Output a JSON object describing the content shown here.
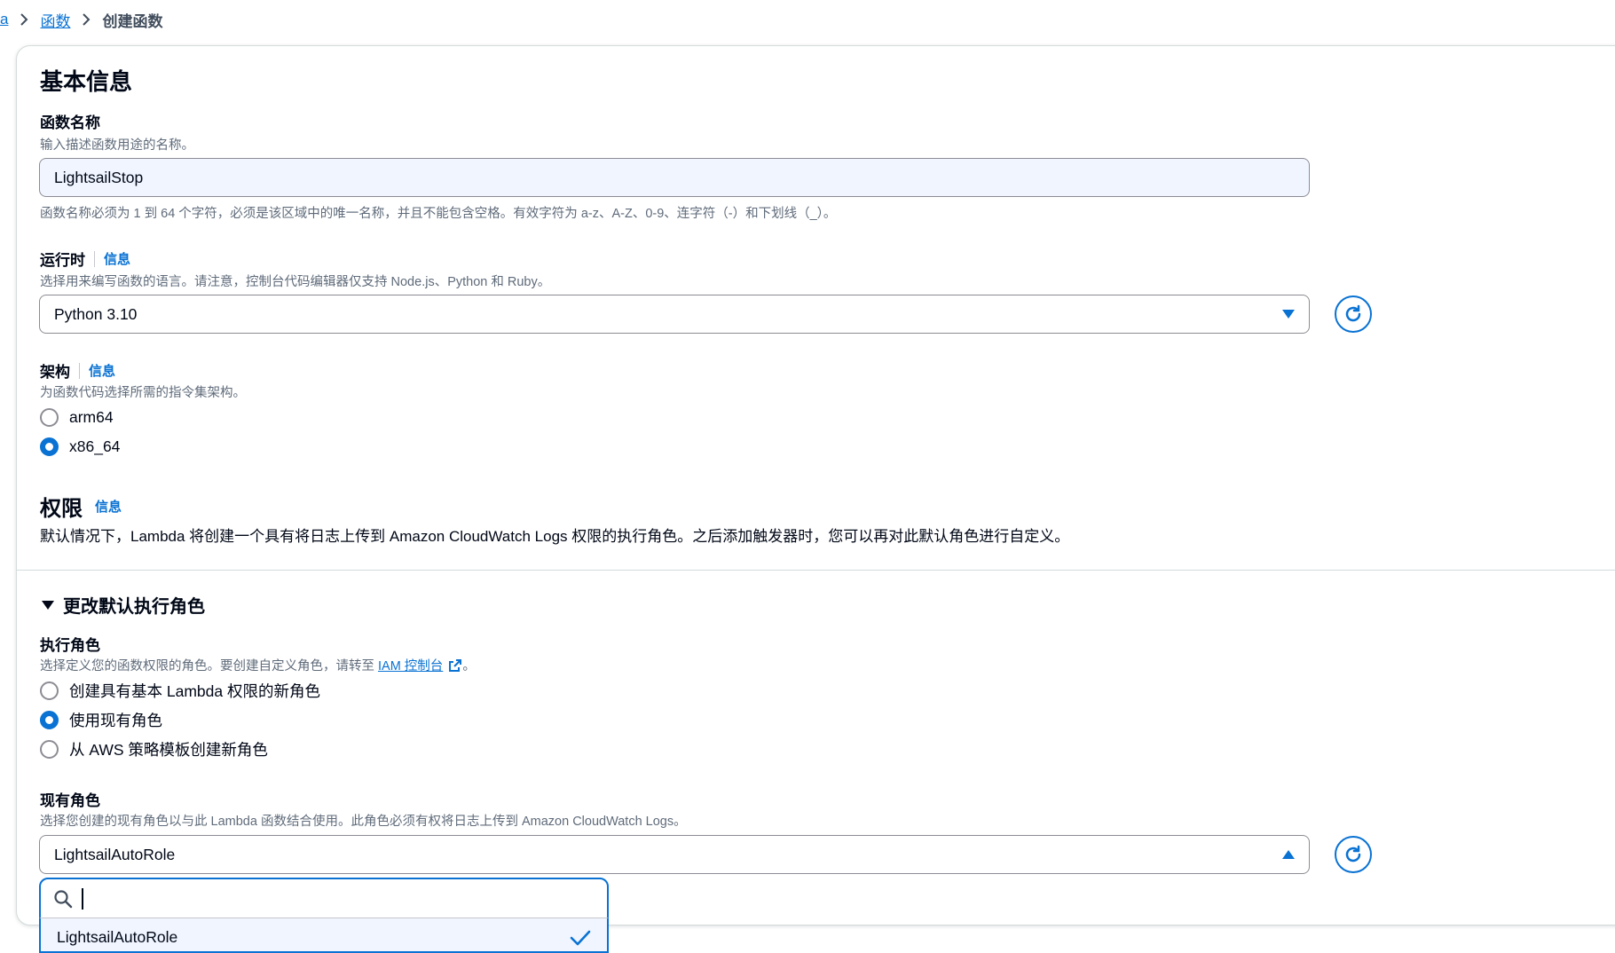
{
  "breadcrumb": {
    "items": [
      "a",
      "函数",
      "创建函数"
    ]
  },
  "basic_info": {
    "title": "基本信息",
    "function_name": {
      "label": "函数名称",
      "description": "输入描述函数用途的名称。",
      "value": "LightsailStop",
      "constraint": "函数名称必须为 1 到 64 个字符，必须是该区域中的唯一名称，并且不能包含空格。有效字符为 a-z、A-Z、0-9、连字符（-）和下划线（_）。"
    },
    "runtime": {
      "label": "运行时",
      "info": "信息",
      "description": "选择用来编写函数的语言。请注意，控制台代码编辑器仅支持 Node.js、Python 和 Ruby。",
      "value": "Python 3.10"
    },
    "architecture": {
      "label": "架构",
      "info": "信息",
      "description": "为函数代码选择所需的指令集架构。",
      "options": [
        {
          "label": "arm64",
          "selected": false
        },
        {
          "label": "x86_64",
          "selected": true
        }
      ]
    }
  },
  "permissions": {
    "title": "权限",
    "info": "信息",
    "description": "默认情况下，Lambda 将创建一个具有将日志上传到 Amazon CloudWatch Logs 权限的执行角色。之后添加触发器时，您可以再对此默认角色进行自定义。",
    "expander": "更改默认执行角色",
    "execution_role": {
      "label": "执行角色",
      "description_prefix": "选择定义您的函数权限的角色。要创建自定义角色，请转至",
      "link": "IAM 控制台",
      "description_suffix": "。",
      "options": [
        {
          "label": "创建具有基本 Lambda 权限的新角色",
          "selected": false
        },
        {
          "label": "使用现有角色",
          "selected": true
        },
        {
          "label": "从 AWS 策略模板创建新角色",
          "selected": false
        }
      ]
    },
    "existing_role": {
      "label": "现有角色",
      "description": "选择您创建的现有角色以与此 Lambda 函数结合使用。此角色必须有权将日志上传到 Amazon CloudWatch Logs。",
      "value": "LightsailAutoRole",
      "search_value": "",
      "dropdown_options": [
        "LightsailAutoRole"
      ]
    }
  },
  "colors": {
    "accent": "#0972d3",
    "border": "#8c8c94",
    "input_fill": "#f0f5ff"
  },
  "icons": [
    "chevron-right-icon",
    "caret-down-icon",
    "caret-up-icon",
    "refresh-icon",
    "external-link-icon",
    "search-icon",
    "check-icon",
    "triangle-down-icon"
  ]
}
